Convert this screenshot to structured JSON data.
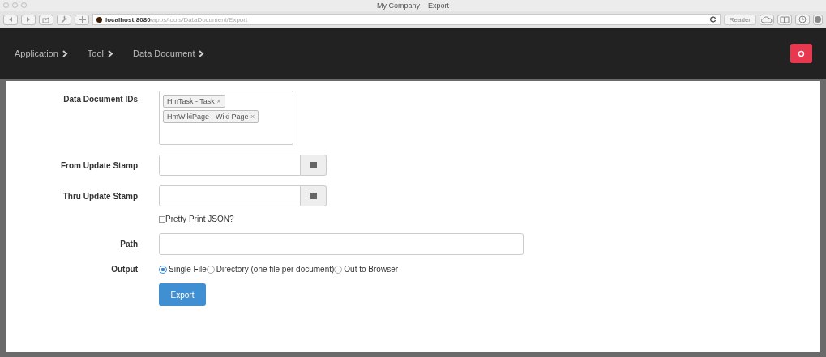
{
  "window": {
    "title": "My Company – Export"
  },
  "toolbar": {
    "url_host": "localhost:8080",
    "url_path": "/apps/tools/DataDocument/Export",
    "reader": "Reader"
  },
  "breadcrumbs": [
    {
      "label": "Application"
    },
    {
      "label": "Tool"
    },
    {
      "label": "Data Document"
    }
  ],
  "form": {
    "ids_label": "Data Document IDs",
    "tags": [
      {
        "label": "HmTask - Task",
        "remove": "×"
      },
      {
        "label": "HmWikiPage - Wiki Page",
        "remove": "×"
      }
    ],
    "from_label": "From Update Stamp",
    "thru_label": "Thru Update Stamp",
    "pretty": {
      "label": "Pretty Print JSON?",
      "checked": false
    },
    "path_label": "Path",
    "output_label": "Output",
    "outputs": [
      {
        "label": "Single File",
        "selected": true
      },
      {
        "label": "Directory (one file per document)",
        "selected": false
      },
      {
        "label": "Out to Browser",
        "selected": false
      }
    ],
    "submit": "Export"
  }
}
